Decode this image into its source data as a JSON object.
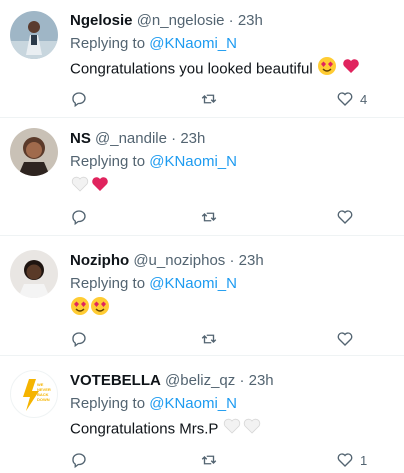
{
  "replies": [
    {
      "name": "Ngelosie",
      "handle": "@n_ngelosie",
      "time": "23h",
      "replying_prefix": "Replying to",
      "replying_to": "@KNaomi_N",
      "text": "Congratulations you looked beautiful",
      "emojis": [
        "heart-eyes-emoji",
        "red-heart-emoji"
      ],
      "like_count": "4"
    },
    {
      "name": "NS",
      "handle": "@_nandile",
      "time": "23h",
      "replying_prefix": "Replying to",
      "replying_to": "@KNaomi_N",
      "text": "",
      "emojis": [
        "white-heart-emoji",
        "red-heart-emoji"
      ],
      "like_count": ""
    },
    {
      "name": "Nozipho",
      "handle": "@u_noziphos",
      "time": "23h",
      "replying_prefix": "Replying to",
      "replying_to": "@KNaomi_N",
      "text": "",
      "emojis": [
        "heart-eyes-emoji",
        "heart-eyes-emoji"
      ],
      "like_count": ""
    },
    {
      "name": "VOTEBELLA",
      "handle": "@beliz_qz",
      "time": "23h",
      "replying_prefix": "Replying to",
      "replying_to": "@KNaomi_N",
      "text": "Congratulations Mrs.P",
      "emojis": [
        "white-heart-emoji",
        "white-heart-emoji"
      ],
      "like_count": "1",
      "avatar_logo_text": "WE NEVER BACK DOWN"
    }
  ],
  "colors": {
    "text": "#0f1419",
    "muted": "#536471",
    "link": "#1d9bf0",
    "divider": "#eff3f4",
    "heart_red": "#e0245e",
    "bolt_yellow": "#f5b400"
  }
}
